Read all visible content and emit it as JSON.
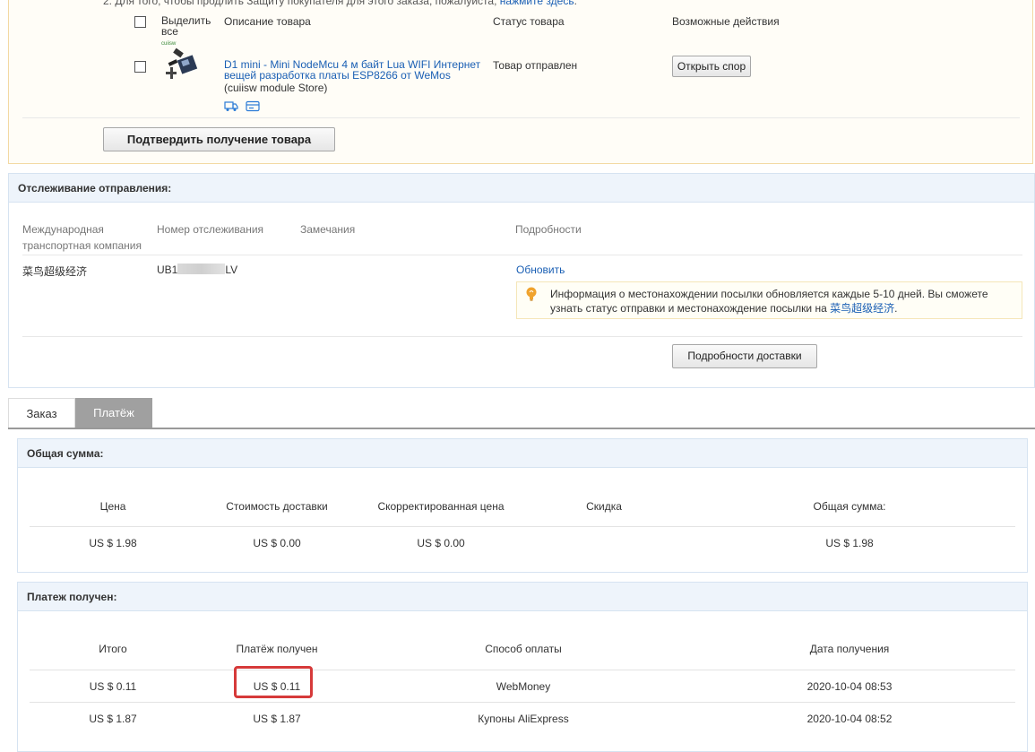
{
  "order": {
    "note_prefix": "2. Для того, чтобы продлить Защиту покупателя для этого заказа, пожалуйста, ",
    "note_link": "нажмите здесь",
    "note_suffix": ".",
    "headers": {
      "select_all": "Выделить все",
      "description": "Описание товара",
      "status": "Статус товара",
      "actions": "Возможные действия"
    },
    "item": {
      "thumb_brand": "cuiisw",
      "title": "D1 mini - Mini NodeMcu 4 м байт Lua WIFI Интернет вещей разработка платы ESP8266 от WeMos",
      "store": "(cuiisw module Store)",
      "status": "Товар отправлен",
      "action_label": "Открыть спор"
    },
    "confirm_label": "Подтвердить получение товара"
  },
  "tracking": {
    "title": "Отслеживание отправления:",
    "headers": {
      "carrier": "Международная транспортная компания",
      "number": "Номер отслеживания",
      "remarks": "Замечания",
      "details": "Подробности"
    },
    "row": {
      "carrier": "菜鸟超级经济",
      "number_start": "UB1",
      "number_end": "LV",
      "refresh": "Обновить"
    },
    "info_text": "Информация о местонахождении посылки обновляется каждые 5-10 дней. Вы сможете узнать статус отправки и местонахождение посылки на ",
    "info_link": "菜鸟超级经济",
    "info_end": ".",
    "delivery_details_label": "Подробности доставки"
  },
  "tabs": [
    {
      "label": "Заказ",
      "active": false
    },
    {
      "label": "Платёж",
      "active": true
    }
  ],
  "totals": {
    "title": "Общая сумма:",
    "headers": [
      "Цена",
      "Стоимость доставки",
      "Скорректированная цена",
      "Скидка",
      "Общая сумма:"
    ],
    "values": [
      "US $ 1.98",
      "US $ 0.00",
      "US $ 0.00",
      "",
      "US $ 1.98"
    ]
  },
  "payment": {
    "title": "Платеж получен:",
    "headers": [
      "Итого",
      "Платёж получен",
      "Способ оплаты",
      "Дата получения"
    ],
    "rows": [
      [
        "US $ 0.11",
        "US $ 0.11",
        "WebMoney",
        "2020-10-04 08:53"
      ],
      [
        "US $ 1.87",
        "US $ 1.87",
        "Купоны AliExpress",
        "2020-10-04 08:52"
      ]
    ]
  },
  "colors": {
    "link": "#1a5fb4",
    "panel_header": "#eef4fb",
    "highlight": "#d63a3a",
    "tab_active": "#a0a0a0"
  }
}
